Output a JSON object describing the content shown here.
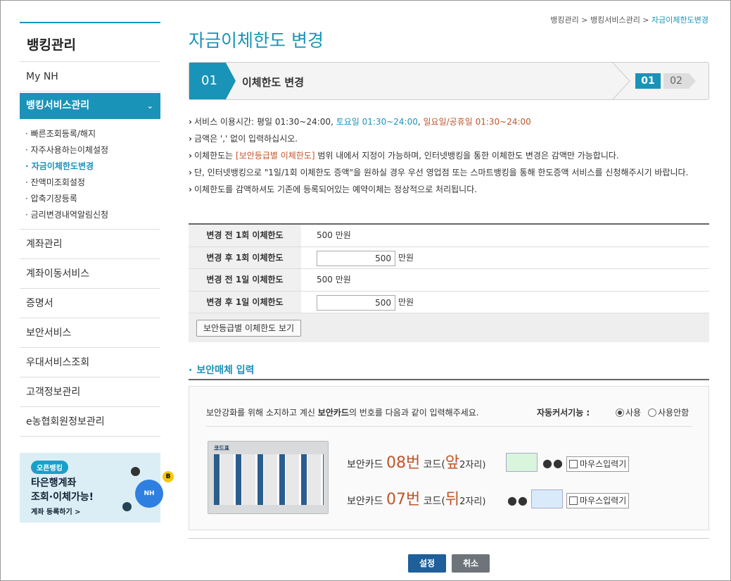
{
  "sidebar": {
    "title": "뱅킹관리",
    "items": [
      {
        "label": "My NH"
      },
      {
        "label": "뱅킹서비스관리"
      },
      {
        "label": "계좌관리"
      },
      {
        "label": "계좌이동서비스"
      },
      {
        "label": "증명서"
      },
      {
        "label": "보안서비스"
      },
      {
        "label": "우대서비스조회"
      },
      {
        "label": "고객정보관리"
      },
      {
        "label": "e농협회원정보관리"
      }
    ],
    "subitems": [
      {
        "label": "· 빠른조회등록/해지"
      },
      {
        "label": "· 자주사용하는이체설정"
      },
      {
        "label": "· 자금이체한도변경"
      },
      {
        "label": "· 잔액미조회설정"
      },
      {
        "label": "· 압축기장등록"
      },
      {
        "label": "· 금리변경내역알림신청"
      }
    ],
    "active_chevron": "chevron-down-icon"
  },
  "banner": {
    "tag": "오픈뱅킹",
    "line1": "타은행계좌",
    "line2": "조회·이체가능!",
    "line3": "계좌 등록하기 >",
    "nh_logo": "NH",
    "kb_logo": "B"
  },
  "breadcrumb": {
    "items": [
      "뱅킹관리 > ",
      "뱅킹서비스관리 > ",
      "자금이체한도변경"
    ]
  },
  "page_title": "자금이체한도 변경",
  "steps": {
    "current_num": "01",
    "current_label": "이체한도 변경",
    "indicator": [
      "01",
      "02"
    ]
  },
  "notes": {
    "n1_a": "서비스 이용시간: 평일 01:30~24:00, ",
    "n1_b": "토요일 01:30~24:00",
    "n1_c": ", ",
    "n1_d": "일요일/공휴일 01:30~24:00",
    "n2": "금액은 ',' 없이 입력하십시오.",
    "n3_a": "이체한도는 ",
    "n3_b": "[보안등급별 이체한도]",
    "n3_c": " 범위 내에서 지정이 가능하며, 인터넷뱅킹을 통한 이체한도 변경은 감액만 가능합니다.",
    "n4": "단, 인터넷뱅킹으로 \"1일/1회 이체한도 증액\"을 원하실 경우 우선 영업점 또는 스마트뱅킹을 통해 한도증액 서비스를 신청해주시기 바랍니다.",
    "n5": "이체한도를 감액하셔도 기존에 등록되어있는 예약이체는 정상적으로 처리됩니다."
  },
  "limit_table": {
    "rows": [
      {
        "label": "변경 전 1회 이체한도",
        "value": "500 만원"
      },
      {
        "label": "변경 후 1회 이체한도",
        "input": "500",
        "unit": "만원"
      },
      {
        "label": "변경 전 1일 이체한도",
        "value": "500 만원"
      },
      {
        "label": "변경 후 1일 이체한도",
        "input": "500",
        "unit": "만원"
      }
    ],
    "grade_button": "보안등급별 이체한도 보기"
  },
  "security": {
    "title": "보안매체 입력",
    "desc_a": "보안강화를 위해 소지하고 계신 ",
    "desc_b": "보안카드",
    "desc_c": "의 번호를 다음과 같이 입력해주세요.",
    "auto_label": "자동커서기능 :",
    "radio_use": "사용",
    "radio_unuse": "사용안함",
    "card_title": "코드표",
    "row1": {
      "prefix": "보안카드 ",
      "num": "08번",
      "code": " 코드(",
      "pos": "앞",
      "suffix": "2자리)",
      "dots": "●●",
      "mouse": "마우스입력기"
    },
    "row2": {
      "prefix": "보안카드 ",
      "num": "07번",
      "code": " 코드(",
      "pos": "뒤",
      "suffix": "2자리)",
      "dots": "●●",
      "mouse": "마우스입력기"
    }
  },
  "buttons": {
    "ok": "설정",
    "cancel": "취소"
  },
  "colors": {
    "accent": "#1a93b8",
    "highlight": "#c0562c",
    "input1_bg": "#d9f5dc",
    "input2_bg": "#d9ebfb"
  }
}
